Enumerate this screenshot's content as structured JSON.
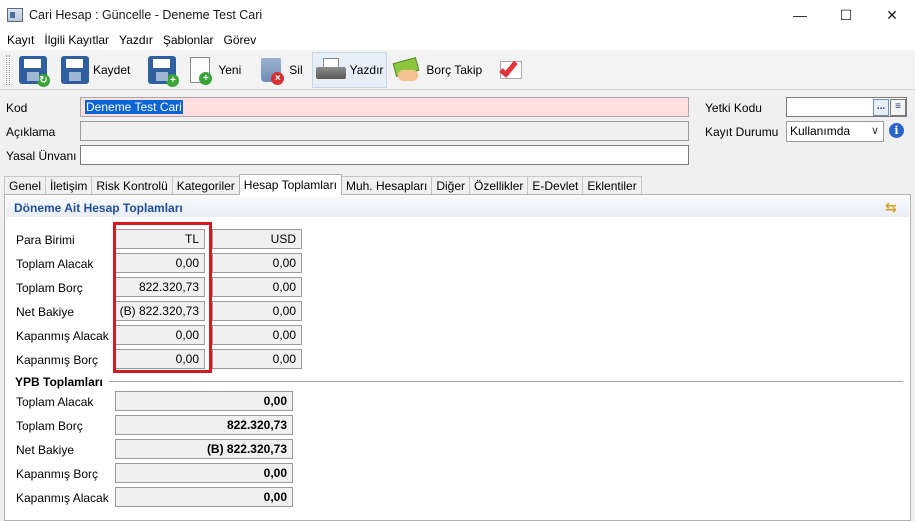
{
  "window": {
    "title": "Cari Hesap : Güncelle - Deneme Test Cari",
    "minimize": "—",
    "maximize": "☐",
    "close": "✕"
  },
  "menu": [
    "Kayıt",
    "İlgili Kayıtlar",
    "Yazdır",
    "Şablonlar",
    "Görev"
  ],
  "toolbar": {
    "save_label": "Kaydet",
    "new_label": "Yeni",
    "delete_label": "Sil",
    "print_label": "Yazdır",
    "debt_follow_label": "Borç Takip"
  },
  "form": {
    "kod_label": "Kod",
    "kod_value": "Deneme Test Cari",
    "aciklama_label": "Açıklama",
    "aciklama_value": "",
    "yasal_unvan_label": "Yasal Ünvanı",
    "yasal_unvan_value": "",
    "yetki_kodu_label": "Yetki Kodu",
    "yetki_kodu_value": "",
    "yetki_btn": "...",
    "kayit_durumu_label": "Kayıt Durumu",
    "kayit_durumu_value": "Kullanımda",
    "info": "i"
  },
  "tabs": [
    "Genel",
    "İletişim",
    "Risk Kontrolü",
    "Kategoriler",
    "Hesap Toplamları",
    "Muh. Hesapları",
    "Diğer",
    "Özellikler",
    "E-Devlet",
    "Eklentiler"
  ],
  "active_tab": "Hesap Toplamları",
  "period_totals": {
    "title": "Döneme Ait Hesap Toplamları",
    "rows": [
      {
        "label": "Para Birimi",
        "tl": "TL",
        "usd": "USD"
      },
      {
        "label": "Toplam Alacak",
        "tl": "0,00",
        "usd": "0,00"
      },
      {
        "label": "Toplam Borç",
        "tl": "822.320,73",
        "usd": "0,00"
      },
      {
        "label": "Net Bakiye",
        "tl": "(B) 822.320,73",
        "usd": "0,00"
      },
      {
        "label": "Kapanmış Alacak",
        "tl": "0,00",
        "usd": "0,00"
      },
      {
        "label": "Kapanmış Borç",
        "tl": "0,00",
        "usd": "0,00"
      }
    ]
  },
  "ypb_totals": {
    "title": "YPB Toplamları",
    "rows": [
      {
        "label": "Toplam Alacak",
        "value": "0,00"
      },
      {
        "label": "Toplam Borç",
        "value": "822.320,73"
      },
      {
        "label": "Net Bakiye",
        "value": "(B) 822.320,73"
      },
      {
        "label": "Kapanmış Borç",
        "value": "0,00"
      },
      {
        "label": "Kapanmış Alacak",
        "value": "0,00"
      }
    ]
  },
  "colors": {
    "highlight": "#d6191f",
    "kod_bg": "#ffdfe0",
    "group_title": "#1f4f9a"
  }
}
